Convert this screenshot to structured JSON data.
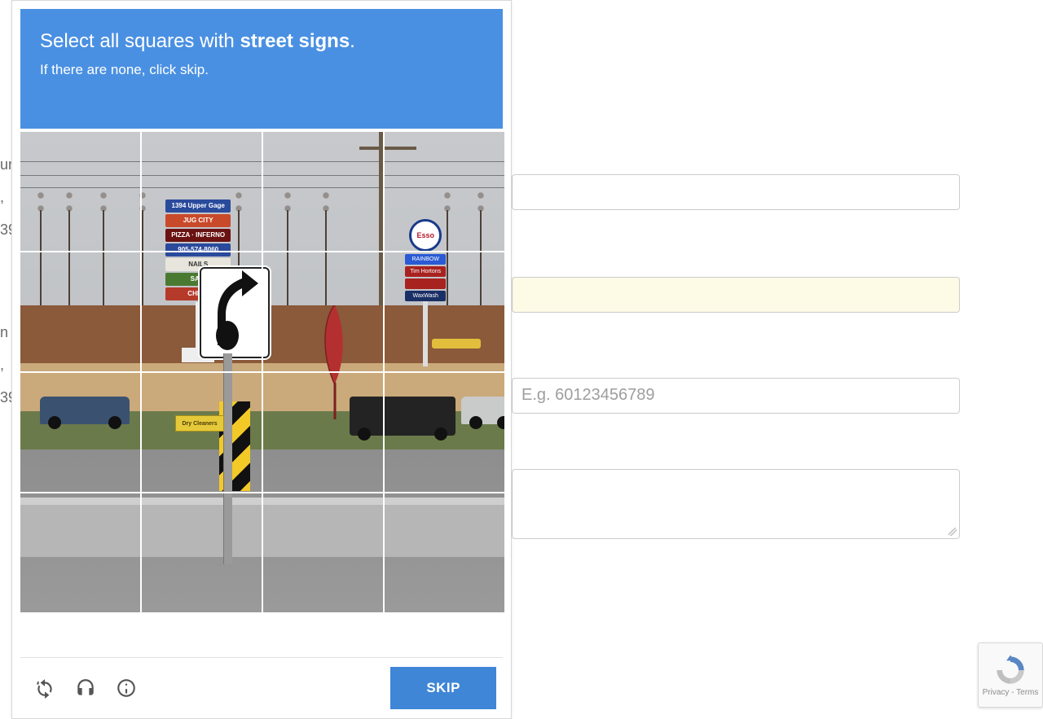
{
  "captcha": {
    "prompt_prefix": "Select all squares with ",
    "prompt_target": "street signs",
    "prompt_suffix": ".",
    "subprompt": "If there are none, click skip.",
    "skip_label": "SKIP",
    "grid": {
      "rows": 4,
      "cols": 4
    },
    "scene": {
      "pylon_boards": [
        "1394 Upper Gage",
        "JUG CITY",
        "PIZZA · INFERNO",
        "905-574-8060",
        "NAILS",
        "SANI",
        "CHIRO"
      ],
      "gas_logo": "Esso",
      "gas_slabs": [
        "RAINBOW",
        "Tim Hortons",
        "",
        "WaxWash"
      ],
      "dry_cleaners": "Dry Cleaners"
    },
    "controls": {
      "reload": "reload-icon",
      "audio": "audio-icon",
      "info": "info-icon"
    }
  },
  "background": {
    "left_text": [
      "un",
      ", ",
      "39",
      "n",
      ", ",
      "39"
    ],
    "phone_placeholder": "E.g. 60123456789"
  },
  "recaptcha_badge": {
    "footer": "Privacy - Terms"
  }
}
